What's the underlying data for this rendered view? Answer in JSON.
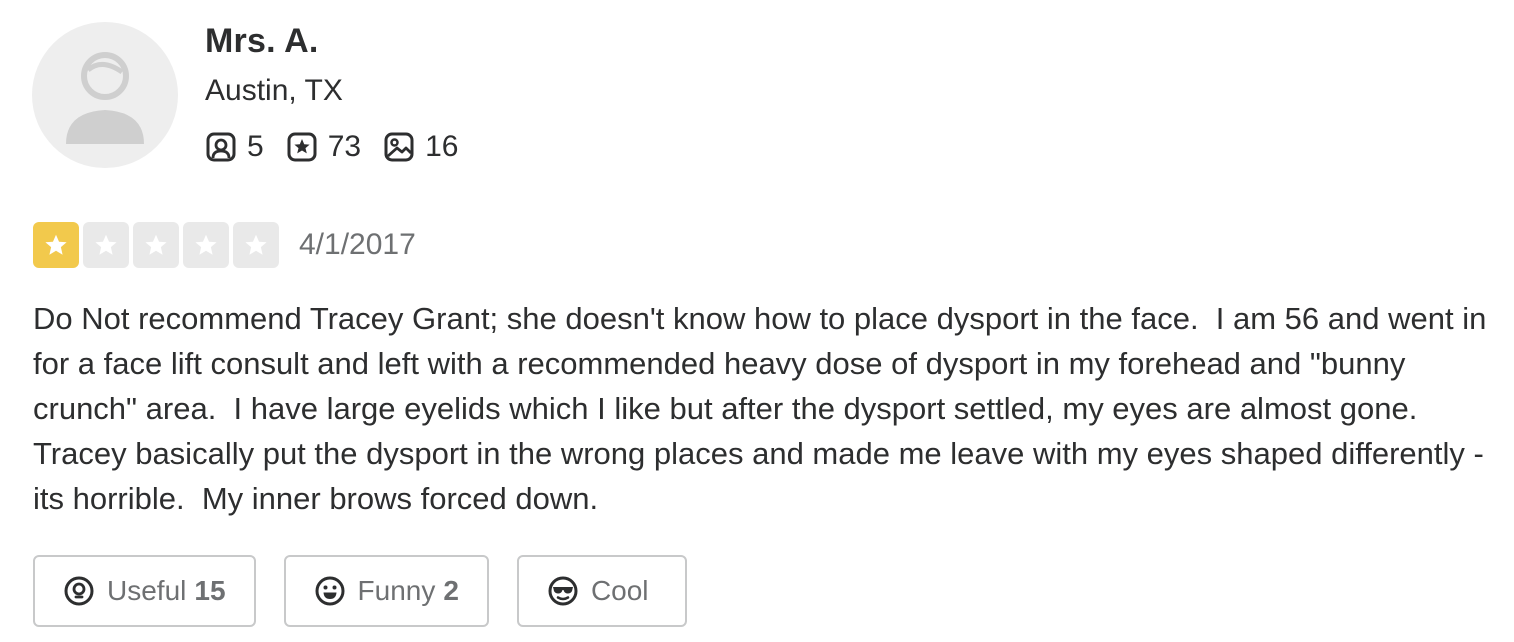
{
  "user": {
    "name": "Mrs. A.",
    "location": "Austin, TX",
    "stats": {
      "friends": "5",
      "reviews": "73",
      "photos": "16"
    }
  },
  "review": {
    "rating": 1,
    "rating_max": 5,
    "date": "4/1/2017",
    "text": "Do Not recommend Tracey Grant; she doesn't know how to place dysport in the face.  I am 56 and went in for a face lift consult and left with a recommended heavy dose of dysport in my forehead and \"bunny crunch\" area.  I have large eyelids which I like but after the dysport settled, my eyes are almost gone.  Tracey basically put the dysport in the wrong places and made me leave with my eyes shaped differently - its horrible.  My inner brows forced down."
  },
  "actions": {
    "useful": {
      "label": "Useful",
      "count": "15"
    },
    "funny": {
      "label": "Funny",
      "count": "2"
    },
    "cool": {
      "label": "Cool",
      "count": ""
    }
  },
  "colors": {
    "star_filled": "#f2c94c",
    "star_empty": "#e9e9e9",
    "text": "#2d2e2f",
    "muted": "#6e7072"
  },
  "icons": {
    "friends": "friends-icon",
    "reviews": "review-star-icon",
    "photos": "photo-icon",
    "useful": "lightbulb-icon",
    "funny": "smiley-icon",
    "cool": "sunglasses-icon"
  }
}
